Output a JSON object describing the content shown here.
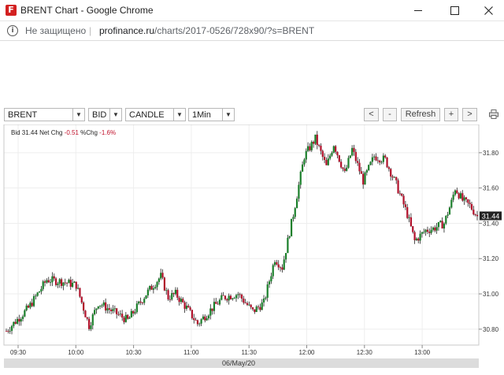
{
  "window": {
    "favicon_letter": "F",
    "title": "BRENT Chart - Google Chrome",
    "min_icon": "minimize-icon",
    "max_icon": "maximize-icon",
    "close_icon": "close-icon"
  },
  "address": {
    "security_text": "Не защищено",
    "separator": "|",
    "host": "profinance.ru",
    "path": "/charts/2017-0526/728x90/?s=BRENT"
  },
  "toolbar": {
    "symbol": "BRENT",
    "price_type": "BID",
    "chart_type": "CANDLE",
    "interval": "1Min",
    "prev_label": "<",
    "zoom_out_label": "-",
    "refresh_label": "Refresh",
    "zoom_in_label": "+",
    "next_label": ">"
  },
  "info": {
    "bid_label": "Bid",
    "bid_value": "31.44",
    "net_chg_label": "Net Chg",
    "net_chg_value": "-0.51",
    "pct_chg_label": "%Chg",
    "pct_chg_value": "-1.6%"
  },
  "colors": {
    "up": "#1a7f2a",
    "down": "#b0102a",
    "axis_text": "#333333",
    "grid": "#eeeeee",
    "last_tag": "#222222"
  },
  "chart_data": {
    "type": "candlestick",
    "symbol": "BRENT",
    "date_label": "06/May/20",
    "x_ticks": [
      "09:30",
      "10:00",
      "10:30",
      "11:00",
      "11:30",
      "12:00",
      "12:30",
      "13:00"
    ],
    "y_ticks": [
      "31.80",
      "31.60",
      "31.40",
      "31.20",
      "31.00",
      "30.80"
    ],
    "ylim": [
      30.71,
      31.96
    ],
    "last_value": "31.44",
    "close_path": [
      [
        0,
        30.79
      ],
      [
        12,
        30.92
      ],
      [
        22,
        31.08
      ],
      [
        30,
        31.07
      ],
      [
        38,
        31.05
      ],
      [
        45,
        30.82
      ],
      [
        50,
        30.95
      ],
      [
        58,
        30.9
      ],
      [
        66,
        30.85
      ],
      [
        76,
        31.0
      ],
      [
        84,
        31.1
      ],
      [
        88,
        30.98
      ],
      [
        92,
        31.0
      ],
      [
        98,
        30.92
      ],
      [
        104,
        30.83
      ],
      [
        112,
        30.92
      ],
      [
        118,
        30.98
      ],
      [
        126,
        31.0
      ],
      [
        134,
        30.9
      ],
      [
        140,
        30.95
      ],
      [
        146,
        31.2
      ],
      [
        150,
        31.15
      ],
      [
        156,
        31.45
      ],
      [
        162,
        31.78
      ],
      [
        168,
        31.88
      ],
      [
        174,
        31.72
      ],
      [
        178,
        31.85
      ],
      [
        184,
        31.68
      ],
      [
        188,
        31.82
      ],
      [
        194,
        31.64
      ],
      [
        200,
        31.78
      ],
      [
        206,
        31.76
      ],
      [
        212,
        31.62
      ],
      [
        218,
        31.45
      ],
      [
        222,
        31.3
      ],
      [
        228,
        31.36
      ],
      [
        232,
        31.37
      ],
      [
        238,
        31.4
      ],
      [
        242,
        31.52
      ],
      [
        244,
        31.6
      ],
      [
        248,
        31.53
      ],
      [
        252,
        31.5
      ],
      [
        256,
        31.44
      ]
    ]
  }
}
